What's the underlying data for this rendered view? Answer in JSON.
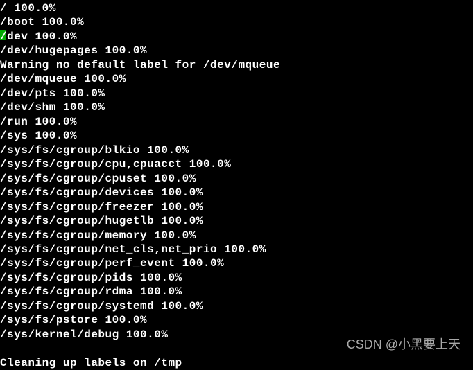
{
  "terminal": {
    "lines": [
      "/ 100.0%",
      "/boot 100.0%",
      "/dev 100.0%",
      "/dev/hugepages 100.0%",
      "Warning no default label for /dev/mqueue",
      "/dev/mqueue 100.0%",
      "/dev/pts 100.0%",
      "/dev/shm 100.0%",
      "/run 100.0%",
      "/sys 100.0%",
      "/sys/fs/cgroup/blkio 100.0%",
      "/sys/fs/cgroup/cpu,cpuacct 100.0%",
      "/sys/fs/cgroup/cpuset 100.0%",
      "/sys/fs/cgroup/devices 100.0%",
      "/sys/fs/cgroup/freezer 100.0%",
      "/sys/fs/cgroup/hugetlb 100.0%",
      "/sys/fs/cgroup/memory 100.0%",
      "/sys/fs/cgroup/net_cls,net_prio 100.0%",
      "/sys/fs/cgroup/perf_event 100.0%",
      "/sys/fs/cgroup/pids 100.0%",
      "/sys/fs/cgroup/rdma 100.0%",
      "/sys/fs/cgroup/systemd 100.0%",
      "/sys/fs/pstore 100.0%",
      "/sys/kernel/debug 100.0%",
      "",
      "Cleaning up labels on /tmp"
    ],
    "green_marker_line": 2
  },
  "watermark": "CSDN @小黑要上天"
}
